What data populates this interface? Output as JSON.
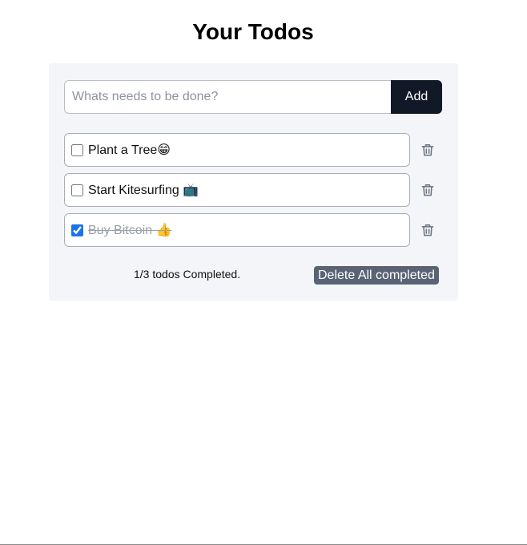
{
  "header": {
    "title": "Your Todos"
  },
  "new_todo": {
    "placeholder": "Whats needs to be done?",
    "value": "",
    "add_label": "Add"
  },
  "todos": [
    {
      "text": "Plant a Tree😁",
      "completed": false,
      "delete_icon": "trash-icon"
    },
    {
      "text": "Start Kitesurfing 📺",
      "completed": false,
      "delete_icon": "trash-icon"
    },
    {
      "text": "Buy Bitcoin 👍",
      "completed": true,
      "delete_icon": "trash-icon"
    }
  ],
  "footer": {
    "summary": "1/3 todos Completed.",
    "delete_all_label": "Delete All completed"
  },
  "colors": {
    "card_background": "#f3f5f8",
    "add_button": "#111827",
    "delete_all_button": "#5a6374",
    "checkbox_accent": "#1a73e8",
    "completed_text": "#9aa0a8"
  }
}
